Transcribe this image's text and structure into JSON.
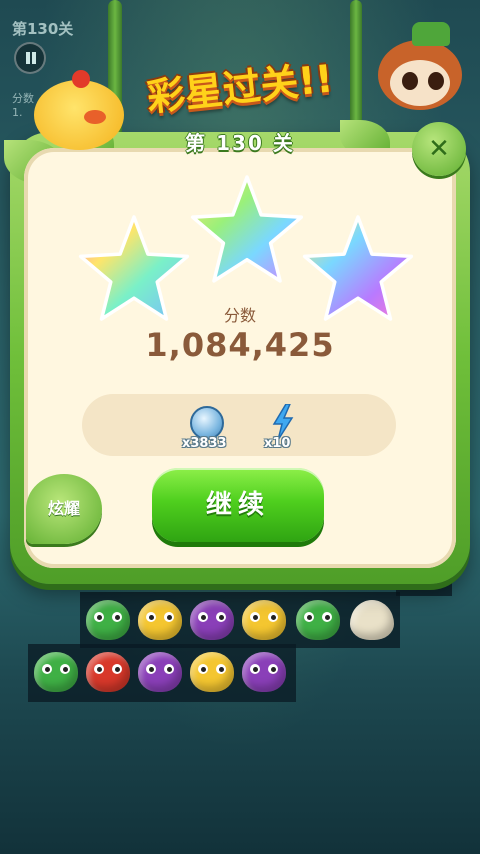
{
  "hud": {
    "level": "第130关",
    "score_label": "分数",
    "score_value": "1."
  },
  "popup": {
    "title": "彩星过关!!",
    "level_label": "第 130 关",
    "stars_earned": 3,
    "stars_total": 3,
    "score_label": "分数",
    "score_value": "1,084,425",
    "rewards": [
      {
        "icon": "coin-icon",
        "amount": "x3833"
      },
      {
        "icon": "lightning-icon",
        "amount": "x10"
      }
    ],
    "continue_label": "继续",
    "show_off_label": "炫耀",
    "close_label": "✕"
  },
  "board_pieces": [
    "frog",
    "chick",
    "owl",
    "chick",
    "frog",
    "egg",
    "frog",
    "fox",
    "owl",
    "chick",
    "owl"
  ],
  "colors": {
    "panel": "#fff7e0",
    "frame": "#6fbf3a",
    "button": "#4fcf1e",
    "score_text": "#8a5a3a"
  }
}
